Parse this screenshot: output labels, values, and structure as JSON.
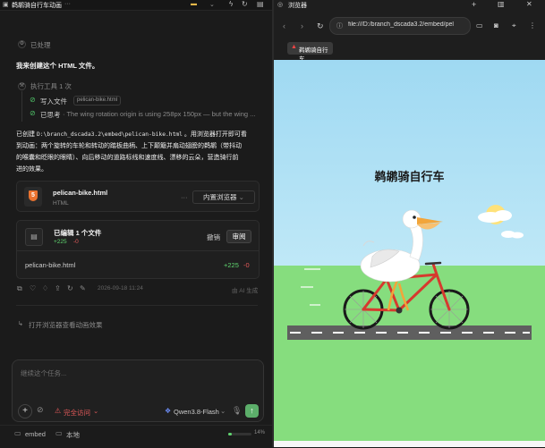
{
  "left": {
    "tab_title": "鹈鹕骑自行车动画",
    "processed_label": "已处理",
    "user_msg": "我来创建这个 HTML 文件。",
    "tool_exec_label": "执行工具 1 次",
    "write_file_label": "写入文件",
    "write_file_name": "pelican-bike.html",
    "thought_label": "已思考",
    "thought_text": "· The wing rotation origin is using 258px 150px — but the wing ...",
    "desc_prefix": "已创建",
    "desc_path": "D:\\branch_dscada3.2\\embed\\pelican-bike.html",
    "desc_line1_suffix": "。用浏览器打开即可看",
    "desc_line2": "到动画：两个旋转的车轮和转动的踏板曲柄、上下颠簸并扇动翅膀的鹈鹕（带抖动",
    "desc_line3": "的喉囊和眨眼的眼睛）、向后移动的道路标线和速度线、漂移的云朵，营造骑行前",
    "desc_line4": "进的效果。",
    "file_card": {
      "name": "pelican-bike.html",
      "type": "HTML",
      "icon_label": "5",
      "browser_button": "内置浏览器",
      "more": "···"
    },
    "edit_card": {
      "title": "已编辑 1 个文件",
      "added": "+225",
      "removed": "-0",
      "undo": "撤销",
      "review": "审阅",
      "file_name": "pelican-bike.html",
      "file_added": "+225",
      "file_removed": "-0"
    },
    "meta": {
      "timestamp": "2026-09-18 11:24",
      "ai_note": "由 AI 生成"
    },
    "suggestion": "打开浏览器查看动画效果",
    "input_placeholder": "继续这个任务...",
    "access_label": "完全访问",
    "model_label": "Qwen3.8-Flash",
    "footer": {
      "folder": "embed",
      "location": "本地",
      "progress_text": "14%"
    }
  },
  "browser": {
    "tab_label": "浏览器",
    "url": "file:///D:/branch_dscada3.2/embed/pel",
    "page_tab": "鹈鹕骑自行车",
    "page_title": "鹈鹕骑自行车"
  },
  "colors": {
    "sky": "#a7ddf4",
    "grass": "#7fd97c",
    "road": "#5f5f5f",
    "frame": "#d63a2e",
    "accent_green": "#4fbf67"
  }
}
